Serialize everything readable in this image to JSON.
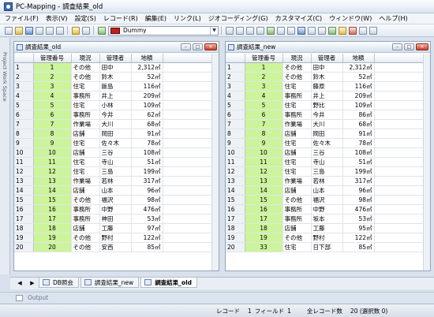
{
  "app": {
    "title": "PC-Mapping - 調査結果_old"
  },
  "menu": [
    "ファイル(F)",
    "表示(V)",
    "設定(S)",
    "レコード(R)",
    "編集(E)",
    "リンク(L)",
    "ジオコーディング(G)",
    "カスタマイズ(C)",
    "ウィンドウ(W)",
    "ヘルプ(H)"
  ],
  "toolbar": {
    "layer_combo_value": "Dummy",
    "layer_color": "#b22222"
  },
  "side_panel": {
    "label": "Project Work Space"
  },
  "columns": [
    "管理番号",
    "現況",
    "管理者",
    "地積"
  ],
  "windows": [
    {
      "title": "調査結果_old",
      "rows": [
        [
          "1",
          "1",
          "その他",
          "田中",
          "2,312㎡"
        ],
        [
          "2",
          "2",
          "その他",
          "鈴木",
          "52㎡"
        ],
        [
          "3",
          "3",
          "住宅",
          "飯島",
          "116㎡"
        ],
        [
          "4",
          "4",
          "事務所",
          "井上",
          "209㎡"
        ],
        [
          "5",
          "5",
          "住宅",
          "小林",
          "109㎡"
        ],
        [
          "6",
          "6",
          "事務所",
          "今井",
          "62㎡"
        ],
        [
          "7",
          "7",
          "作業場",
          "大川",
          "68㎡"
        ],
        [
          "8",
          "8",
          "店舗",
          "岡田",
          "91㎡"
        ],
        [
          "9",
          "9",
          "住宅",
          "佐々木",
          "78㎡"
        ],
        [
          "10",
          "10",
          "店舗",
          "三谷",
          "108㎡"
        ],
        [
          "11",
          "11",
          "住宅",
          "寺山",
          "51㎡"
        ],
        [
          "12",
          "12",
          "住宅",
          "三島",
          "199㎡"
        ],
        [
          "13",
          "13",
          "作業場",
          "若林",
          "317㎡"
        ],
        [
          "14",
          "14",
          "店舗",
          "山本",
          "96㎡"
        ],
        [
          "15",
          "15",
          "その他",
          "福沢",
          "98㎡"
        ],
        [
          "16",
          "16",
          "事務所",
          "中野",
          "476㎡"
        ],
        [
          "17",
          "17",
          "事務所",
          "神田",
          "53㎡"
        ],
        [
          "18",
          "18",
          "店舗",
          "工藤",
          "97㎡"
        ],
        [
          "19",
          "19",
          "その他",
          "野村",
          "122㎡"
        ],
        [
          "20",
          "20",
          "その他",
          "安西",
          "85㎡"
        ]
      ]
    },
    {
      "title": "調査結果_new",
      "rows": [
        [
          "1",
          "1",
          "その他",
          "田中",
          "2,312㎡"
        ],
        [
          "2",
          "2",
          "その他",
          "鈴木",
          "52㎡"
        ],
        [
          "3",
          "3",
          "住宅",
          "藤原",
          "116㎡"
        ],
        [
          "4",
          "4",
          "事務所",
          "井上",
          "209㎡"
        ],
        [
          "5",
          "5",
          "住宅",
          "野比",
          "109㎡"
        ],
        [
          "6",
          "6",
          "事務所",
          "今井",
          "86㎡"
        ],
        [
          "7",
          "7",
          "作業場",
          "大川",
          "68㎡"
        ],
        [
          "8",
          "8",
          "店舗",
          "岡田",
          "91㎡"
        ],
        [
          "9",
          "9",
          "住宅",
          "佐々木",
          "78㎡"
        ],
        [
          "10",
          "10",
          "店舗",
          "三谷",
          "108㎡"
        ],
        [
          "11",
          "11",
          "住宅",
          "寺山",
          "51㎡"
        ],
        [
          "12",
          "12",
          "住宅",
          "三島",
          "199㎡"
        ],
        [
          "13",
          "13",
          "作業場",
          "若林",
          "317㎡"
        ],
        [
          "14",
          "14",
          "店舗",
          "山本",
          "96㎡"
        ],
        [
          "15",
          "15",
          "その他",
          "福沢",
          "98㎡"
        ],
        [
          "16",
          "16",
          "事務所",
          "中野",
          "476㎡"
        ],
        [
          "17",
          "17",
          "事務所",
          "坂本",
          "53㎡"
        ],
        [
          "18",
          "18",
          "店舗",
          "工藤",
          "95㎡"
        ],
        [
          "19",
          "19",
          "その他",
          "野村",
          "122㎡"
        ],
        [
          "20",
          "33",
          "住宅",
          "日下部",
          "85㎡"
        ]
      ]
    }
  ],
  "bottom_tabs": [
    {
      "label": "DB照会"
    },
    {
      "label": "調査結果_new"
    },
    {
      "label": "調査結果_old"
    }
  ],
  "output": {
    "label": "Output"
  },
  "status": {
    "record_label": "レコード",
    "record_value": "1",
    "field_label": "フィールド",
    "field_value": "1",
    "total_label": "全レコード数",
    "total_value": "20 (選択数 0)"
  }
}
